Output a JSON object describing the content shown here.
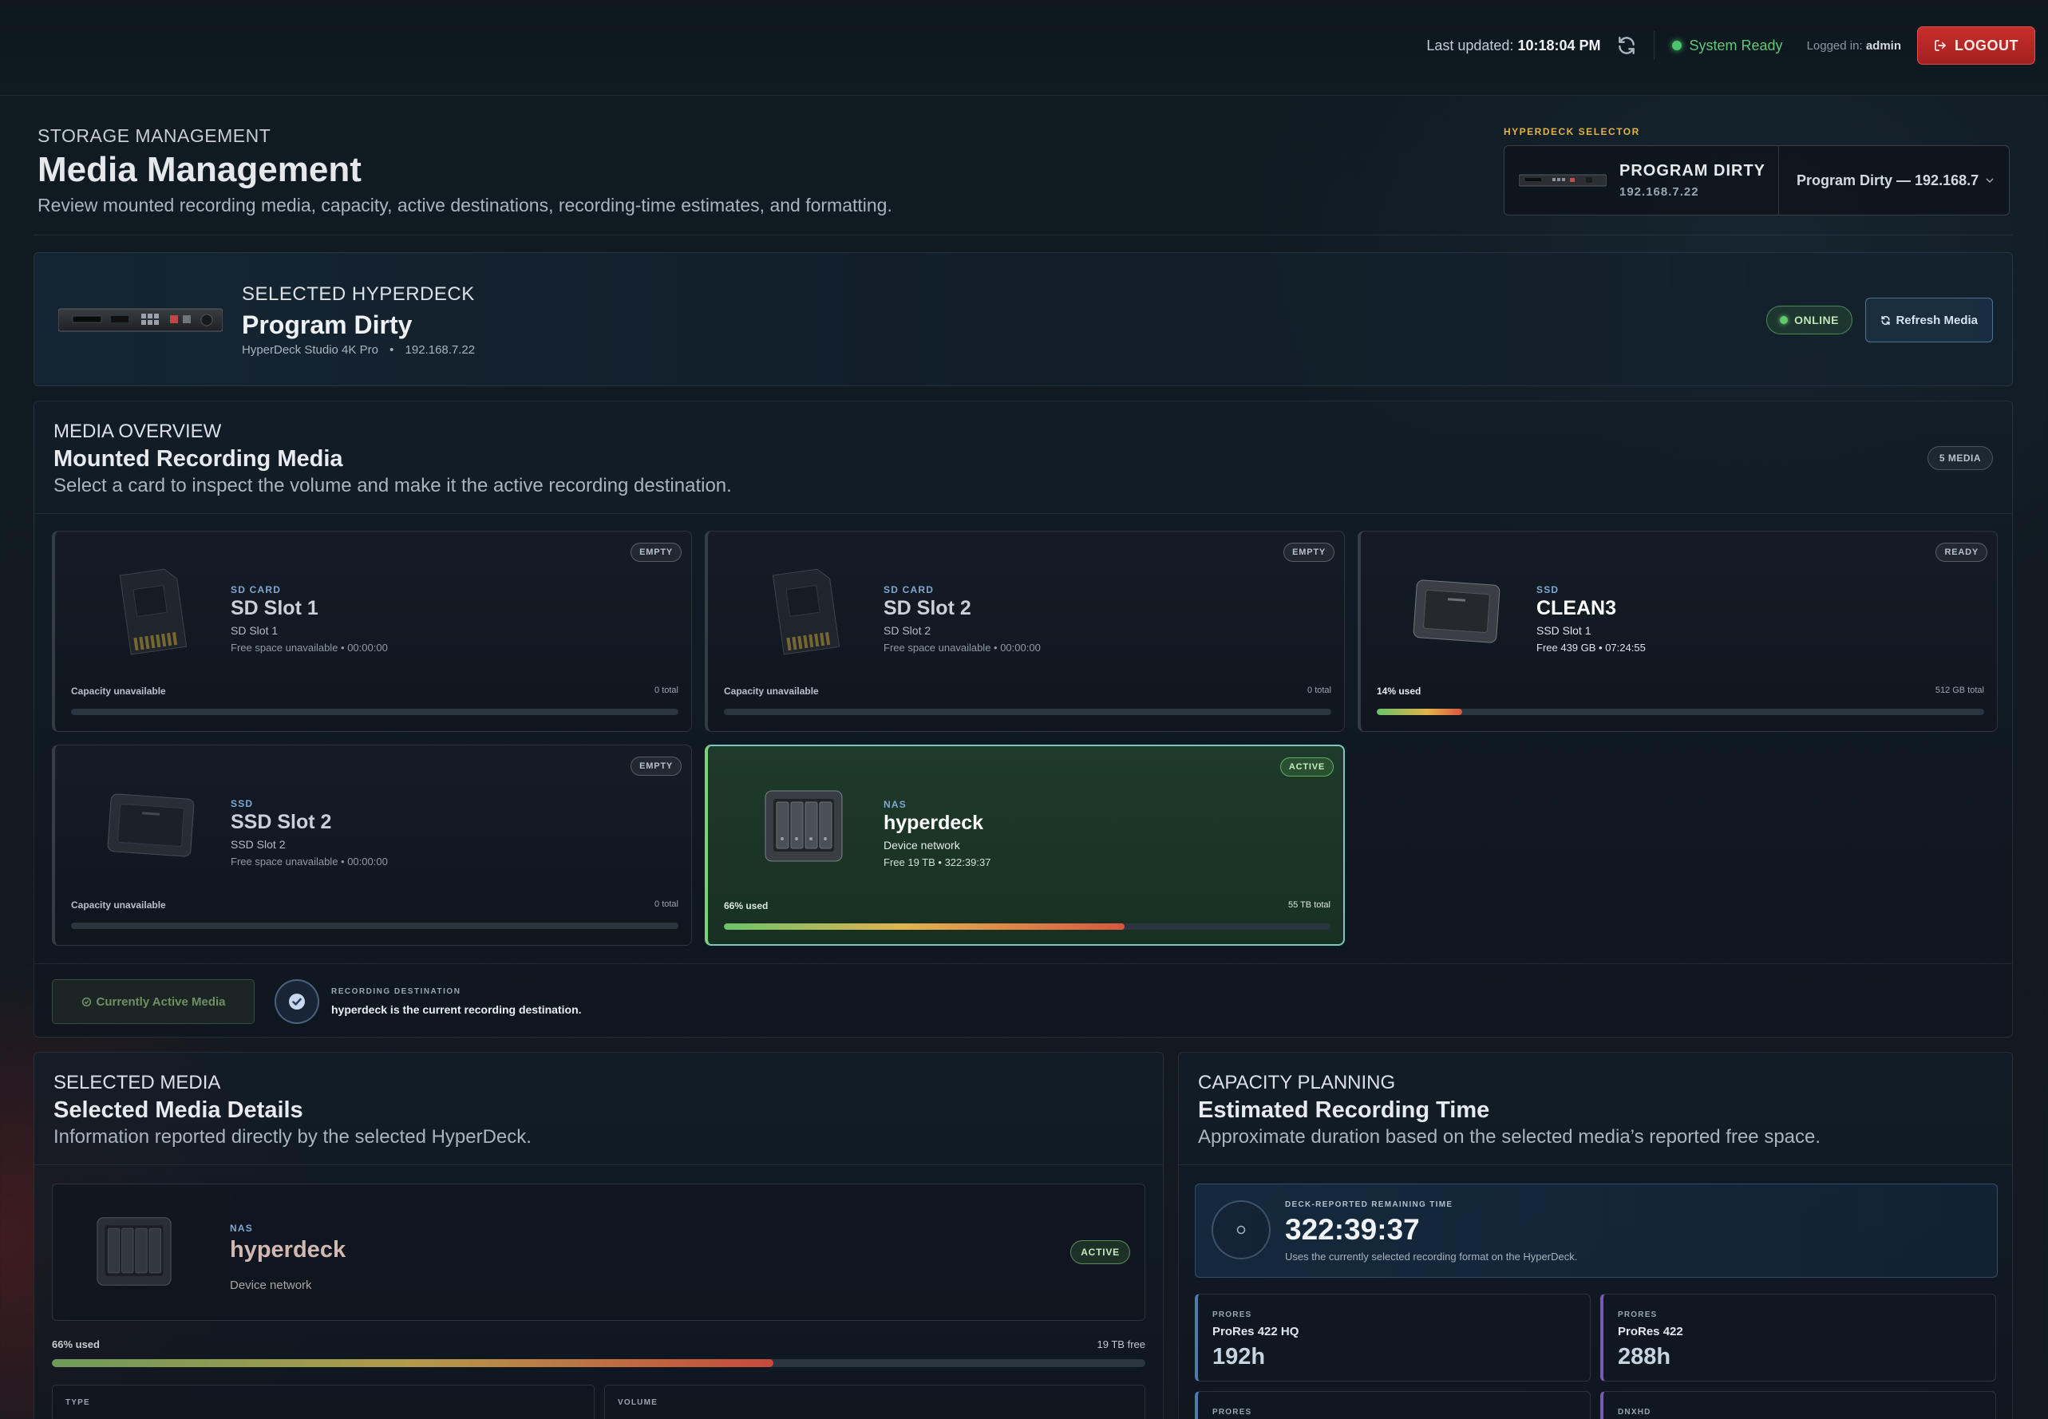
{
  "topbar": {
    "last_updated_label": "Last updated:",
    "last_updated_time": "10:18:04 PM",
    "system_status": "System Ready",
    "logged_in_label": "Logged in:",
    "logged_in_user": "admin",
    "logout_label": "LOGOUT"
  },
  "header": {
    "eyebrow": "STORAGE MANAGEMENT",
    "title": "Media Management",
    "subtitle": "Review mounted recording media, capacity, active destinations, recording-time estimates, and formatting."
  },
  "hyperdeck_selector": {
    "label": "HYPERDECK SELECTOR",
    "name": "PROGRAM DIRTY",
    "ip": "192.168.7.22",
    "selected_option": "Program Dirty — 192.168.7"
  },
  "selected_hyperdeck": {
    "eyebrow": "SELECTED HYPERDECK",
    "name": "Program Dirty",
    "model": "HyperDeck Studio 4K Pro",
    "separator": "•",
    "ip": "192.168.7.22",
    "status": "ONLINE",
    "refresh_label": "Refresh Media"
  },
  "media_overview": {
    "eyebrow": "MEDIA OVERVIEW",
    "title": "Mounted Recording Media",
    "subtitle": "Select a card to inspect the volume and make it the active recording destination.",
    "count": "5 MEDIA",
    "cards": [
      {
        "kind": "SD CARD",
        "name": "SD Slot 1",
        "sub1": "SD Slot 1",
        "sub2": "Free space unavailable • 00:00:00",
        "badge": "EMPTY",
        "cap_left": "Capacity unavailable",
        "cap_right": "0 total",
        "used": 0
      },
      {
        "kind": "SD CARD",
        "name": "SD Slot 2",
        "sub1": "SD Slot 2",
        "sub2": "Free space unavailable • 00:00:00",
        "badge": "EMPTY",
        "cap_left": "Capacity unavailable",
        "cap_right": "0 total",
        "used": 0
      },
      {
        "kind": "SSD",
        "name": "CLEAN3",
        "sub1": "SSD Slot 1",
        "sub2": "Free 439 GB • 07:24:55",
        "badge": "READY",
        "cap_left": "14% used",
        "cap_right": "512 GB total",
        "used": 14
      },
      {
        "kind": "SSD",
        "name": "SSD Slot 2",
        "sub1": "SSD Slot 2",
        "sub2": "Free space unavailable • 00:00:00",
        "badge": "EMPTY",
        "cap_left": "Capacity unavailable",
        "cap_right": "0 total",
        "used": 0
      },
      {
        "kind": "NAS",
        "name": "hyperdeck",
        "sub1": "Device network",
        "sub2": "Free 19 TB • 322:39:37",
        "badge": "ACTIVE",
        "cap_left": "66% used",
        "cap_right": "55 TB total",
        "used": 66
      }
    ],
    "current_active_label": "Currently Active Media",
    "recording_destination_label": "RECORDING DESTINATION",
    "recording_destination_text": "hyperdeck is the current recording destination."
  },
  "selected_media": {
    "eyebrow": "SELECTED MEDIA",
    "title": "Selected Media Details",
    "subtitle": "Information reported directly by the selected HyperDeck.",
    "kind": "NAS",
    "name": "hyperdeck",
    "sub": "Device network",
    "badge": "ACTIVE",
    "used_label": "66% used",
    "free_label": "19 TB free",
    "used": 66,
    "fields": [
      {
        "label": "TYPE"
      },
      {
        "label": "VOLUME"
      }
    ]
  },
  "capacity_planning": {
    "eyebrow": "CAPACITY PLANNING",
    "title": "Estimated Recording Time",
    "subtitle": "Approximate duration based on the selected media’s reported free space.",
    "remaining_label": "DECK-REPORTED REMAINING TIME",
    "remaining_value": "322:39:37",
    "remaining_sub": "Uses the currently selected recording format on the HyperDeck.",
    "formats": [
      {
        "kind": "PRORES",
        "name": "ProRes 422 HQ",
        "value": "192h"
      },
      {
        "kind": "PRORES",
        "name": "ProRes 422",
        "value": "288h"
      },
      {
        "kind": "PRORES",
        "name": "",
        "value": ""
      },
      {
        "kind": "DNXHD",
        "name": "",
        "value": ""
      }
    ]
  },
  "colors": {
    "accent_blue": "#7fa7d4",
    "status_green": "#4cc46b",
    "logout_red": "#c62e2b",
    "selector_label_gold": "#e1b248"
  }
}
